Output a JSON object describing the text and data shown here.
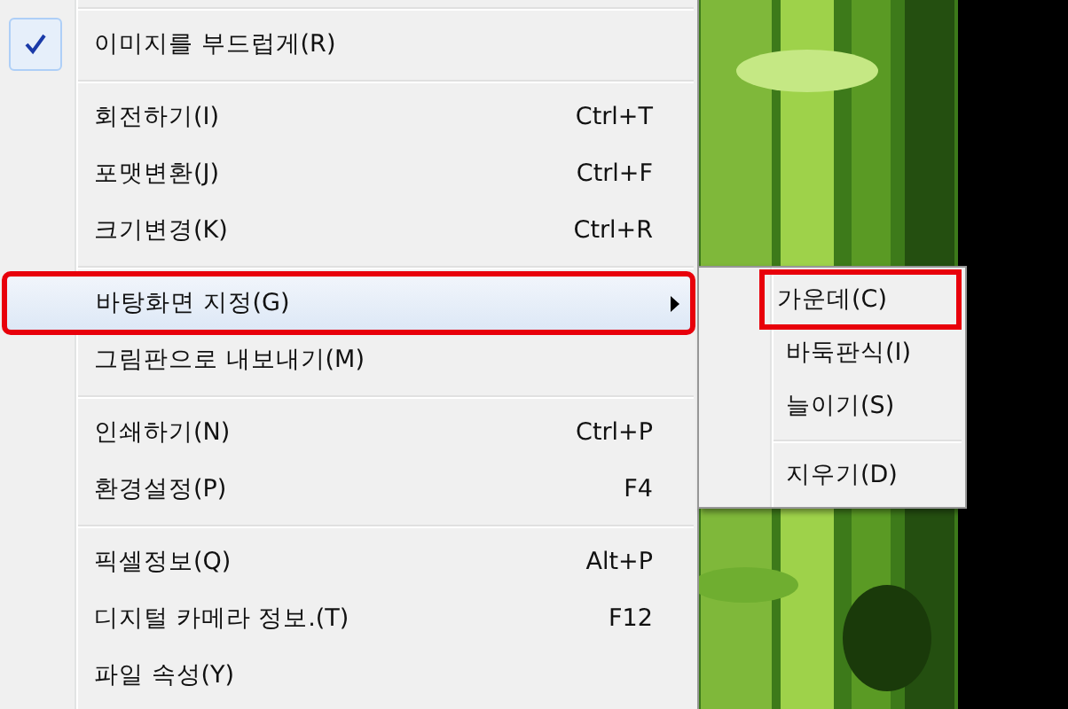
{
  "menu": {
    "items": [
      {
        "kind": "separator"
      },
      {
        "kind": "item",
        "label": "이미지를 부드럽게(R)",
        "checked": true,
        "highlighted": false,
        "annotated": false
      },
      {
        "kind": "separator"
      },
      {
        "kind": "item",
        "label": "회전하기(I)",
        "shortcut": "Ctrl+T",
        "checked": false,
        "highlighted": false,
        "annotated": false
      },
      {
        "kind": "item",
        "label": "포맷변환(J)",
        "shortcut": "Ctrl+F",
        "checked": false,
        "highlighted": false,
        "annotated": false
      },
      {
        "kind": "item",
        "label": "크기변경(K)",
        "shortcut": "Ctrl+R",
        "checked": false,
        "highlighted": false,
        "annotated": false
      },
      {
        "kind": "separator"
      },
      {
        "kind": "submenu",
        "label": "바탕화면 지정(G)",
        "checked": false,
        "highlighted": true,
        "annotated": true
      },
      {
        "kind": "item",
        "label": "그림판으로 내보내기(M)",
        "checked": false,
        "highlighted": false,
        "annotated": false
      },
      {
        "kind": "separator"
      },
      {
        "kind": "item",
        "label": "인쇄하기(N)",
        "shortcut": "Ctrl+P",
        "checked": false,
        "highlighted": false,
        "annotated": false
      },
      {
        "kind": "item",
        "label": "환경설정(P)",
        "shortcut": "F4",
        "checked": false,
        "highlighted": false,
        "annotated": false
      },
      {
        "kind": "separator"
      },
      {
        "kind": "item",
        "label": "픽셀정보(Q)",
        "shortcut": "Alt+P",
        "checked": false,
        "highlighted": false,
        "annotated": false
      },
      {
        "kind": "item",
        "label": "디지털 카메라 정보.(T)",
        "shortcut": "F12",
        "checked": false,
        "highlighted": false,
        "annotated": false
      },
      {
        "kind": "item",
        "label": "파일 속성(Y)",
        "checked": false,
        "highlighted": false,
        "annotated": false
      }
    ]
  },
  "submenu": {
    "items": [
      {
        "kind": "item",
        "label": "가운데(C)",
        "annotated": true
      },
      {
        "kind": "item",
        "label": "바둑판식(I)",
        "annotated": false
      },
      {
        "kind": "item",
        "label": "늘이기(S)",
        "annotated": false
      },
      {
        "kind": "separator"
      },
      {
        "kind": "item",
        "label": "지우기(D)",
        "annotated": false
      }
    ]
  }
}
